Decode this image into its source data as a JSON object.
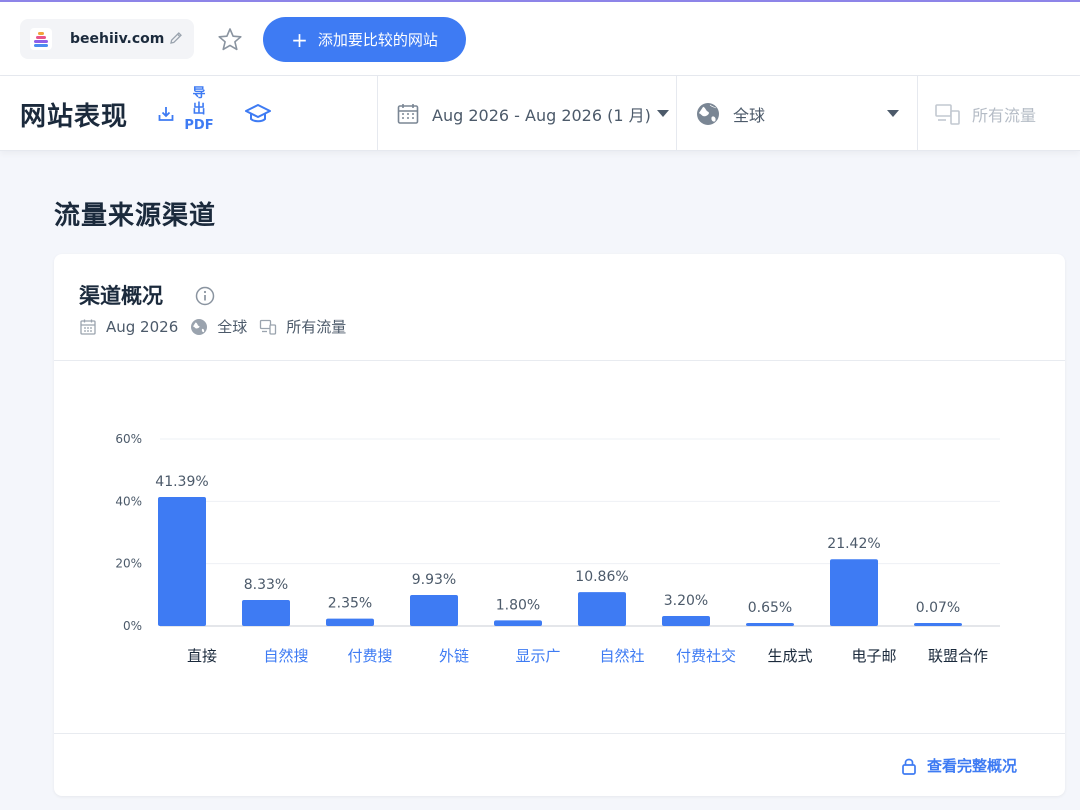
{
  "colors": {
    "accent": "#3e7bf3",
    "bar": "#3e7bf3",
    "accent_line": "#8d84e8"
  },
  "topbar": {
    "site_name": "beehiiv.com",
    "add_compare_label": "添加要比较的网站",
    "add_icon": "plus-icon"
  },
  "header": {
    "page_title": "网站表现",
    "export_line1": "导",
    "export_line2": "出",
    "export_line3": "PDF",
    "date_range": "Aug 2026 - Aug 2026 (1 月)",
    "region": "全球",
    "traffic": "所有流量"
  },
  "section": {
    "title": "流量来源渠道"
  },
  "card": {
    "title": "渠道概况",
    "meta_date": "Aug 2026",
    "meta_region": "全球",
    "meta_traffic": "所有流量",
    "footer_link": "查看完整概况"
  },
  "chart_data": {
    "type": "bar",
    "categories": [
      "直接",
      "自然搜",
      "付费搜",
      "外链",
      "显示广",
      "自然社",
      "付费社交",
      "生成式",
      "电子邮",
      "联盟合作"
    ],
    "values": [
      41.39,
      8.33,
      2.35,
      9.93,
      1.8,
      10.86,
      3.2,
      0.65,
      21.42,
      0.07
    ],
    "data_labels": [
      "41.39%",
      "8.33%",
      "2.35%",
      "9.93%",
      "1.80%",
      "10.86%",
      "3.20%",
      "0.65%",
      "21.42%",
      "0.07%"
    ],
    "category_link": [
      false,
      true,
      true,
      true,
      true,
      true,
      true,
      false,
      false,
      false
    ],
    "yticks": [
      0,
      20,
      40,
      60
    ],
    "ytick_labels": [
      "0%",
      "20%",
      "40%",
      "60%"
    ],
    "ylim": [
      0,
      60
    ],
    "grid": true
  }
}
